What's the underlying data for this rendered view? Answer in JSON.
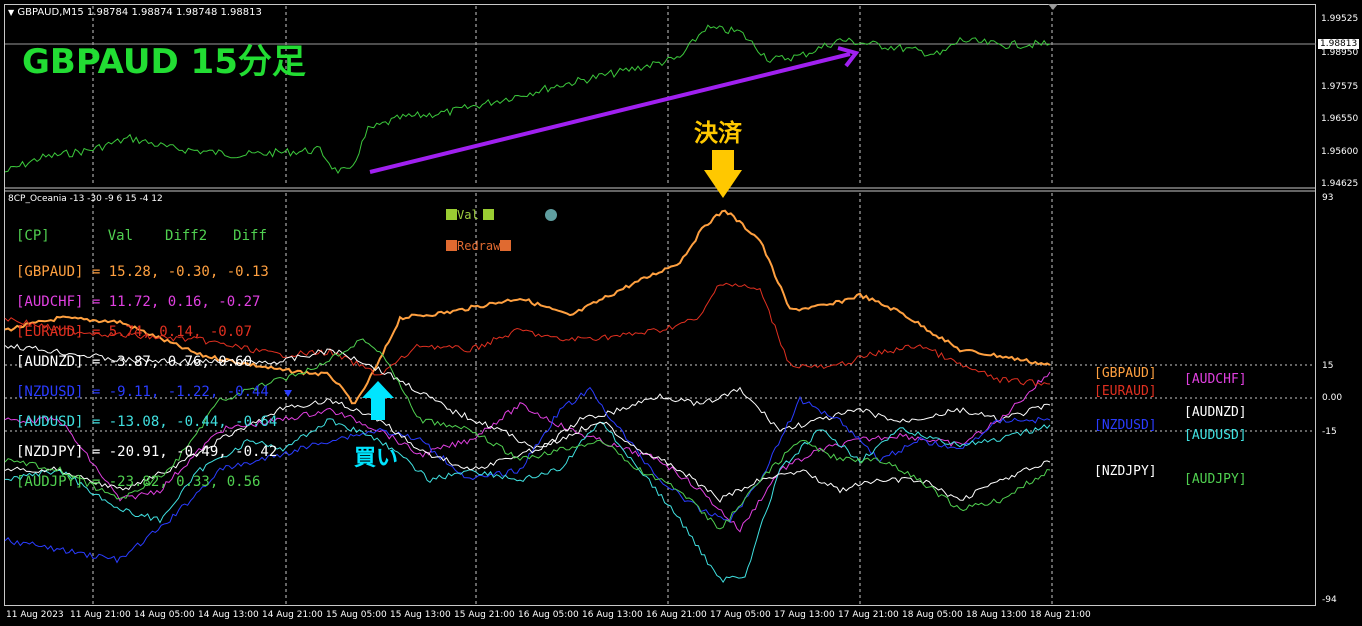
{
  "price_panel": {
    "header": "GBPAUD,M15  1.98784 1.98874 1.98748 1.98813",
    "title": "GBPAUD 15分足",
    "current_price": "1.98813",
    "axis_ticks": [
      "1.99525",
      "1.98950",
      "1.97575",
      "1.96550",
      "1.95600",
      "1.94625"
    ]
  },
  "indicator_panel": {
    "header": "8CP_Oceania -13 -30 -9 6 15 -4 12",
    "axis_top": "93",
    "axis_bottom": "-94",
    "axis_ticks": [
      "15",
      "0.00",
      "-15"
    ],
    "legend": {
      "val": "Val",
      "redraw": "Redraw"
    },
    "table_header": {
      "cp": "[CP]",
      "val": "Val",
      "diff2": "Diff2",
      "diff": "Diff"
    },
    "rows": [
      {
        "text": "[GBPAUD] =  15.28,  -0.30,  -0.13",
        "color": "#ffa040"
      },
      {
        "text": "[AUDCHF] =  11.72,   0.16,  -0.27",
        "color": "#e040e0"
      },
      {
        "text": "[EURAUD] =   5.74,   0.14,  -0.07",
        "color": "#e03020"
      },
      {
        "text": "[AUDNZD] =  -3.87,   0.76,   0.60",
        "color": "#ffffff"
      },
      {
        "text": "[NZDUSD] =  -9.11,  -1.22,  -0.44",
        "color": "#2a3cff"
      },
      {
        "text": "[AUDUSD] = -13.08,  -0.44,  -0.64",
        "color": "#40e0e0"
      },
      {
        "text": "[NZDJPY] = -20.91,  -0.49,  -0.42",
        "color": "#ffffff"
      },
      {
        "text": "[AUDJPY] = -23.82,   0.33,   0.56",
        "color": "#50d050"
      }
    ],
    "right_labels": [
      {
        "text": "[GBPAUD]",
        "color": "#ffa040"
      },
      {
        "text": "[AUDCHF]",
        "color": "#e040e0"
      },
      {
        "text": "[EURAUD]",
        "color": "#e03020"
      },
      {
        "text": "[AUDNZD]",
        "color": "#ffffff"
      },
      {
        "text": "[NZDUSD]",
        "color": "#2a3cff"
      },
      {
        "text": "[AUDUSD]",
        "color": "#40e0e0"
      },
      {
        "text": "[NZDJPY]",
        "color": "#ffffff"
      },
      {
        "text": "[AUDJPY]",
        "color": "#50d050"
      }
    ],
    "buy_label": "買い",
    "exit_label": "決済"
  },
  "x_axis": [
    "11 Aug 2023",
    "11 Aug 21:00",
    "14 Aug 05:00",
    "14 Aug 13:00",
    "14 Aug 21:00",
    "15 Aug 05:00",
    "15 Aug 13:00",
    "15 Aug 21:00",
    "16 Aug 05:00",
    "16 Aug 13:00",
    "16 Aug 21:00",
    "17 Aug 05:00",
    "17 Aug 13:00",
    "17 Aug 21:00",
    "18 Aug 05:00",
    "18 Aug 13:00",
    "18 Aug 21:00"
  ],
  "colors": {
    "price_line": "#3cc83c",
    "trend_arrow": "#a020f0",
    "buy_arrow": "#00e5ff",
    "exit_arrow": "#ffc800",
    "title": "#22dd33"
  }
}
